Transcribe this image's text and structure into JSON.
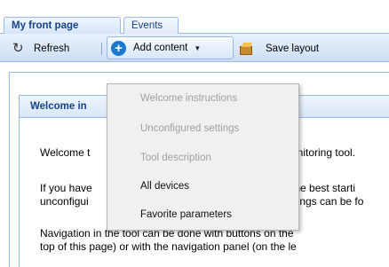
{
  "tabs": [
    {
      "label": "My front page",
      "active": true
    },
    {
      "label": "Events",
      "active": false
    }
  ],
  "toolbar": {
    "refresh_label": "Refresh",
    "add_content_label": "Add content",
    "save_layout_label": "Save layout"
  },
  "panel": {
    "title": "Welcome in",
    "para1_left": "Welcome t",
    "para1_right": "onitoring tool.",
    "para2_line1_left": "If you have",
    "para2_line1_right": "the best starti",
    "para2_line2_left": "unconfigui",
    "para2_line2_right": "ttings can be fo",
    "para3_line1": "Navigation in the tool can be done with buttons on the",
    "para3_line2": "top of this page) or with the navigation panel (on the le"
  },
  "menu": {
    "items": [
      {
        "label": "Welcome instructions",
        "enabled": false
      },
      {
        "label": "Unconfigured settings",
        "enabled": false
      },
      {
        "label": "Tool description",
        "enabled": false
      },
      {
        "label": "All devices",
        "enabled": true
      },
      {
        "label": "Favorite parameters",
        "enabled": true
      }
    ]
  },
  "icons": {
    "refresh": "refresh-icon",
    "add": "add-icon",
    "save": "save-layout-icon",
    "dropdown": "chevron-down-icon"
  },
  "colors": {
    "accent": "#15428b",
    "border": "#99bbe8",
    "add_icon": "#1a78d0"
  }
}
